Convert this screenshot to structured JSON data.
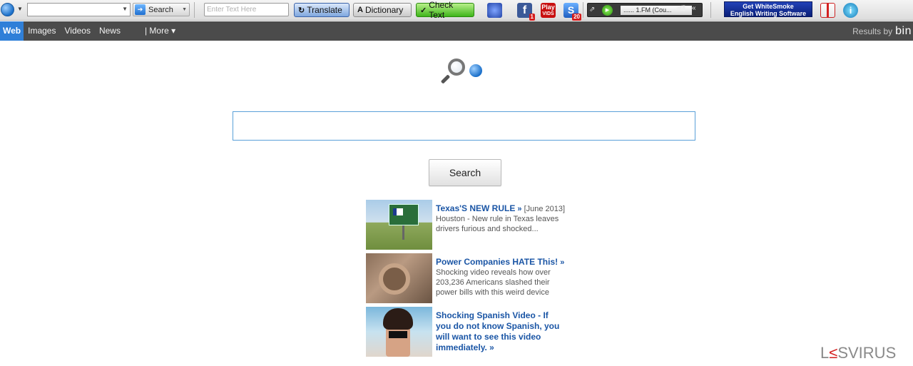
{
  "toolbar": {
    "search_label": "Search",
    "translate_placeholder": "Enter Text Here",
    "translate_label": "Translate",
    "dictionary_label": "Dictionary",
    "check_label": "Check Text",
    "dictionary_glyph": "A",
    "check_glyph": "✓",
    "fb_glyph": "f",
    "fb_badge": "1",
    "play_label": "Play",
    "play_sub": "VIDS",
    "s_glyph": "S",
    "s_badge": "20",
    "radio_station": "...... 1.FM (Cou...",
    "whitesmoke_line1": "Get WhiteSmoke",
    "whitesmoke_line2": "English Writing Software",
    "info_glyph": "i"
  },
  "nav": {
    "web": "Web",
    "images": "Images",
    "videos": "Videos",
    "news": "News",
    "more": "| More ▾",
    "results_by": "Results by",
    "bing": "bin"
  },
  "main": {
    "search_value": "",
    "search_button": "Search"
  },
  "ads": [
    {
      "title": "Texas'S NEW RULE",
      "more": "»",
      "body": "[June 2013] Houston - New rule in Texas leaves drivers furious and shocked..."
    },
    {
      "title": "Power Companies HATE This!",
      "more": "»",
      "body": "Shocking video reveals how over 203,236 Americans slashed their power bills with this weird device"
    },
    {
      "title": "Shocking Spanish Video - If you do not know Spanish, you will want to see this video immediately.",
      "more": "»",
      "body": ""
    }
  ],
  "watermark": {
    "a": "L",
    "red": "≤",
    "b": "SVIRUS"
  }
}
